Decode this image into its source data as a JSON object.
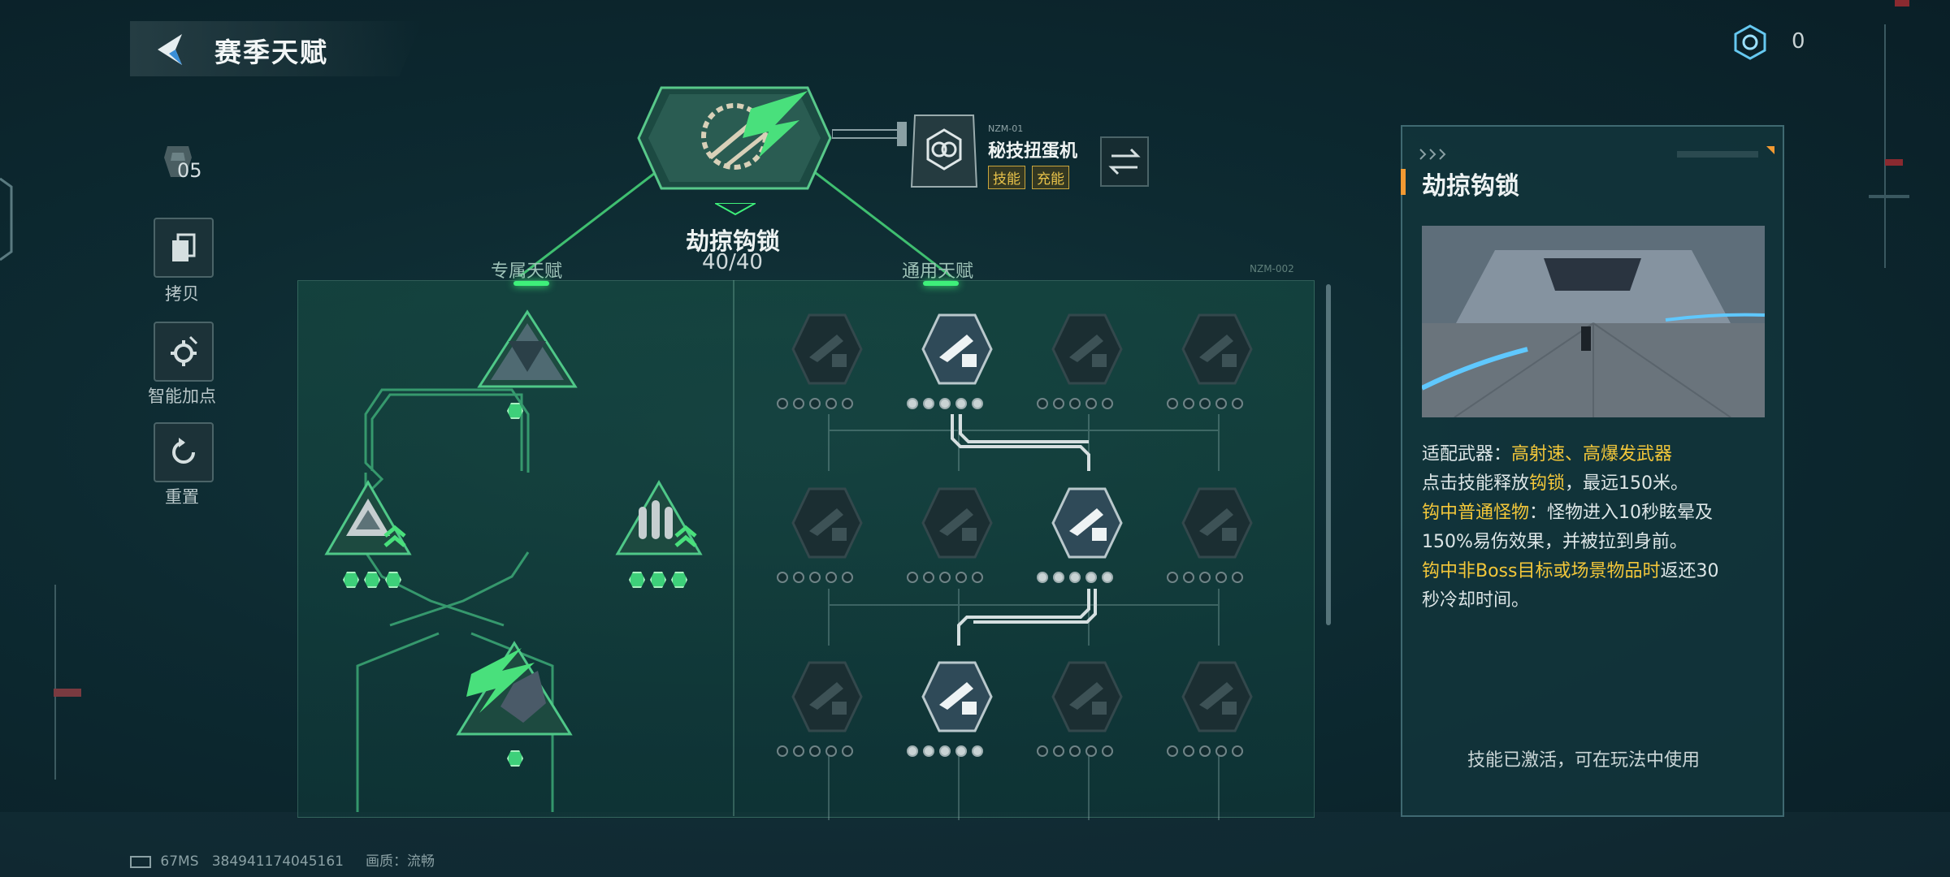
{
  "header": {
    "title": "赛季天赋",
    "currency_count": "0"
  },
  "sidebar": {
    "points": "05",
    "copy_label": "拷贝",
    "auto_label": "智能加点",
    "reset_label": "重置"
  },
  "top_skill": {
    "name": "劫掠钩锁",
    "progress": "40/40",
    "module_code": "NZM-01",
    "module_name": "秘技扭蛋机",
    "tag1": "技能",
    "tag2": "充能"
  },
  "tree": {
    "exclusive_label": "专属天赋",
    "general_label": "通用天赋",
    "panel_code": "NZM-002"
  },
  "detail": {
    "title": "劫掠钩锁",
    "line1_prefix": "适配武器：",
    "line1_highlight": "高射速、高爆发武器",
    "line2_a": "点击技能释放",
    "line2_hl": "钩锁",
    "line2_b": "，最远150米。",
    "line3_hl": "钩中普通怪物",
    "line3_b": "：怪物进入10秒眩晕及",
    "line4": "150%易伤效果，并被拉到身前。",
    "line5_hl": "钩中非Boss目标或场景物品时",
    "line5_b": "返还30",
    "line6": "秒冷却时间。",
    "status": "技能已激活，可在玩法中使用"
  },
  "footer": {
    "ping": "67MS",
    "uid": "384941174045161",
    "quality_label": "画质：",
    "quality_value": "流畅"
  },
  "colors": {
    "accent_green": "#3ef07a",
    "highlight_yellow": "#f3c73a",
    "title_accent": "#f29a32"
  }
}
